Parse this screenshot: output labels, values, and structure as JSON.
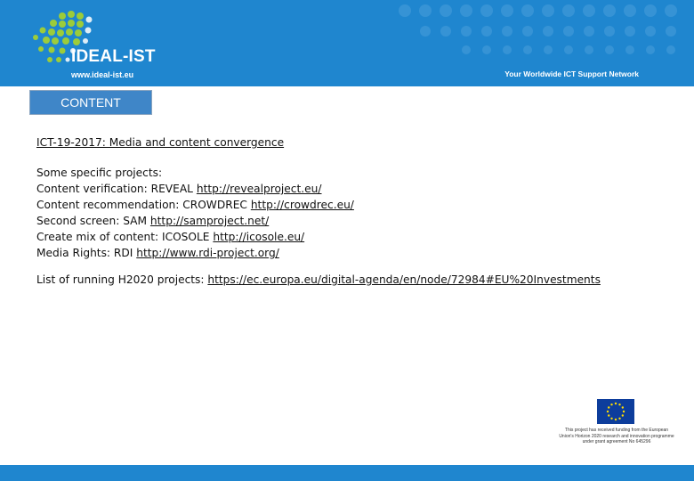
{
  "header": {
    "logo_name": "IDEAL-IST",
    "logo_url": "www.ideal-ist.eu",
    "tagline": "Your Worldwide ICT Support Network"
  },
  "section_tab": "CONTENT",
  "topic": "ICT-19-2017: Media and content convergence",
  "intro": "Some specific projects:",
  "projects": [
    {
      "label": "Content verification: REVEAL ",
      "link": "http://revealproject.eu/"
    },
    {
      "label": "Content recommendation: CROWDREC ",
      "link": "http://crowdrec.eu/"
    },
    {
      "label": "Second screen: SAM ",
      "link": "http://samproject.net/"
    },
    {
      "label": "Create mix of content: ICOSOLE ",
      "link": "http://icosole.eu/"
    },
    {
      "label": "Media Rights: RDI ",
      "link": "http://www.rdi-project.org/"
    }
  ],
  "running": {
    "label": "List of running H2020 projects: ",
    "link": "https://ec.europa.eu/digital-agenda/en/node/72984#EU%20Investments"
  },
  "eu_note": "This project has received funding from the European Union's Horizon 2020 research and innovation programme under grant agreement No 645296",
  "colors": {
    "header_blue": "#1f86cf",
    "tab_blue": "#3f86c8",
    "logo_green": "#9ccc3a",
    "eu_blue": "#0d3d9c",
    "eu_star": "#ffdd00"
  },
  "icons": [
    "logo-dots-icon",
    "eu-flag-icon"
  ]
}
